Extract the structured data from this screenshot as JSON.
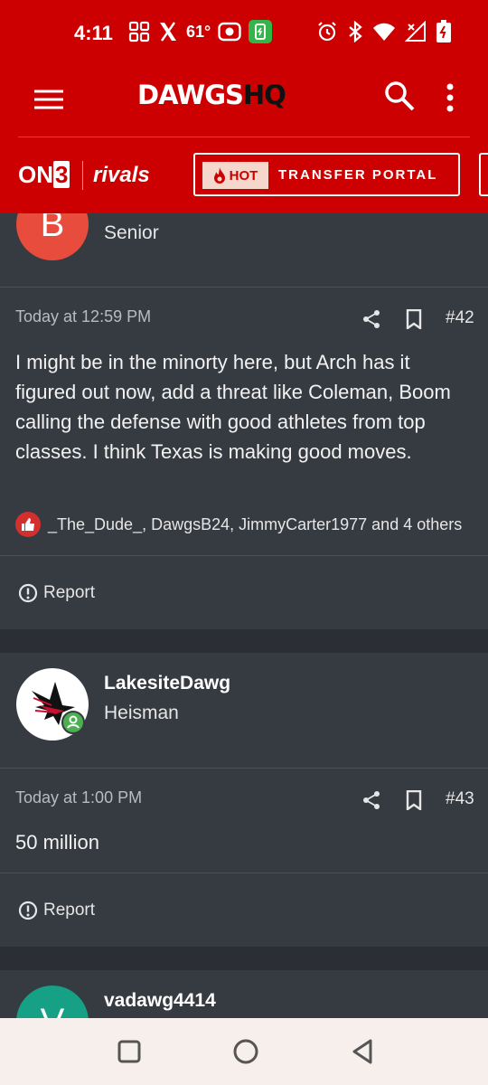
{
  "status_bar": {
    "time": "4:11",
    "temp": "61°",
    "icons_left": [
      "grid-icon",
      "x-icon",
      "weather-text",
      "record-icon",
      "battery-saver-icon"
    ],
    "icons_right": [
      "alarm-icon",
      "bluetooth-icon",
      "wifi-icon",
      "signal-icon",
      "battery-icon"
    ]
  },
  "header": {
    "logo_main": "DAWGS",
    "logo_suffix": "HQ",
    "menu_icon": "hamburger-icon",
    "search_icon": "search-icon",
    "more_icon": "more-vertical-icon"
  },
  "partners": {
    "on3_prefix": "ON",
    "on3_num": "3",
    "rivals": "rivals",
    "hot_badge": "HOT",
    "portal_label": "TRANSFER PORTAL"
  },
  "posts": [
    {
      "avatar_letter": "B",
      "rank": "Senior",
      "timestamp": "Today at 12:59 PM",
      "post_number": "#42",
      "body": "I might be in the minorty here, but Arch has it figured out now, add a threat like Coleman, Boom calling the defense with good athletes from top classes. I think Texas is making good moves.",
      "reactions": "_The_Dude_, DawgsB24, JimmyCarter1977 and 4 others",
      "report_label": "Report"
    },
    {
      "username": "LakesiteDawg",
      "rank": "Heisman",
      "timestamp": "Today at 1:00 PM",
      "post_number": "#43",
      "body": "50 million",
      "report_label": "Report"
    },
    {
      "avatar_letter": "V",
      "username": "vadawg4414"
    }
  ],
  "colors": {
    "brand_red": "#cc0000",
    "card_bg": "#363a41",
    "page_bg": "#2b2f35",
    "avatar_b": "#e74c3c",
    "avatar_v": "#16a085"
  }
}
